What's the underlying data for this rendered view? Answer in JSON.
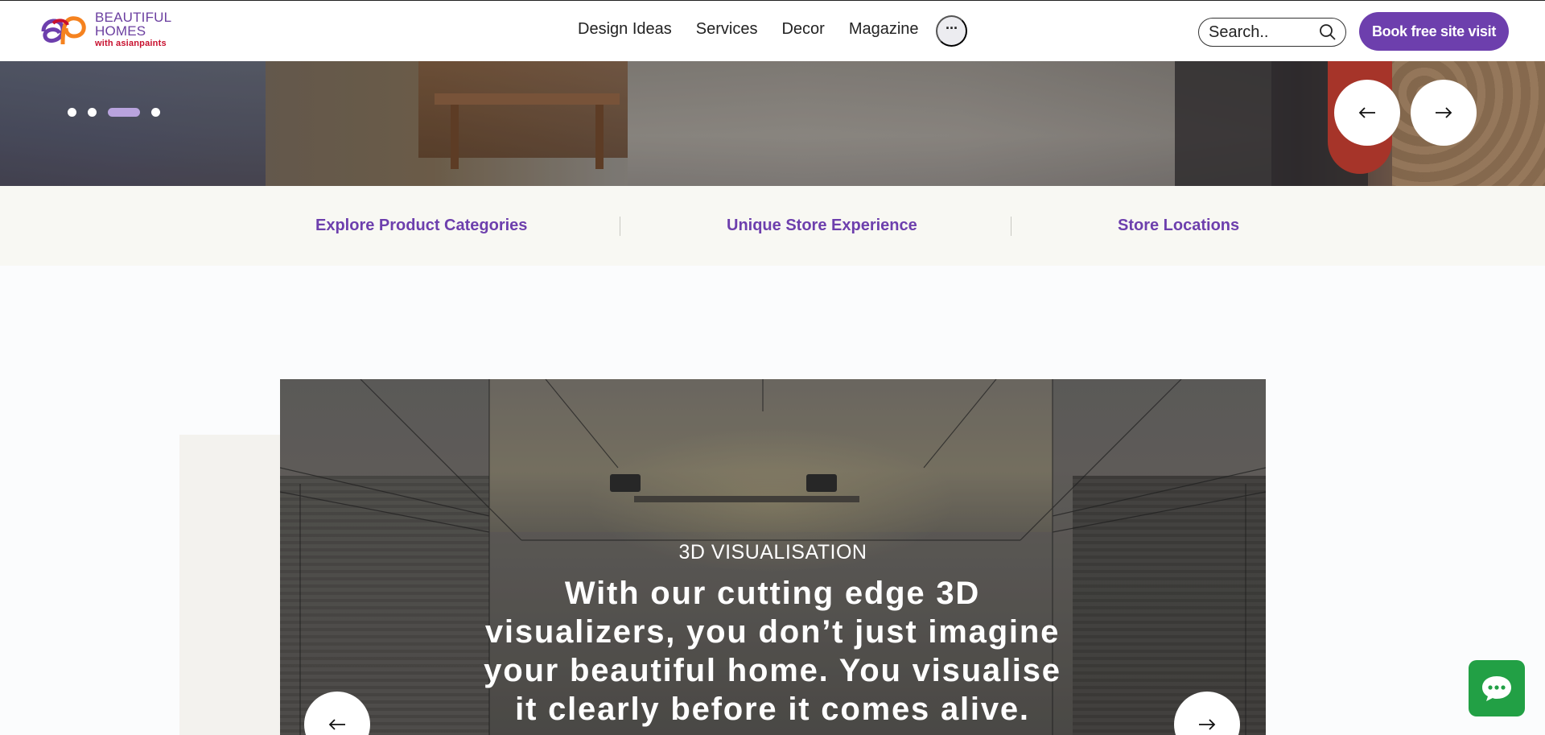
{
  "brand": {
    "line1": "BEAUTIFUL",
    "line2": "HOMES",
    "line3": "with asianpaints",
    "colors": {
      "purple": "#6d3fad",
      "red": "#c8102e",
      "orange": "#f5821f"
    }
  },
  "nav": {
    "items": [
      {
        "label": "Design Ideas"
      },
      {
        "label": "Services"
      },
      {
        "label": "Decor"
      },
      {
        "label": "Magazine"
      }
    ],
    "more_icon": "ellipsis-icon"
  },
  "search": {
    "placeholder": "Search..",
    "icon": "search-icon"
  },
  "cta": {
    "book_label": "Book free site visit",
    "color": "#6d3fad"
  },
  "hero": {
    "slides_total": 4,
    "active_slide": 3,
    "prev_icon": "arrow-left-icon",
    "next_icon": "arrow-right-icon"
  },
  "quick_links": [
    {
      "label": "Explore Product Categories"
    },
    {
      "label": "Unique Store Experience"
    },
    {
      "label": "Store Locations"
    }
  ],
  "feature_card": {
    "eyebrow": "3D VISUALISATION",
    "heading": "With our cutting edge 3D visualizers, you don’t just imagine your beautiful home. You visualise it clearly before it comes alive.",
    "prev_icon": "arrow-left-icon",
    "next_icon": "arrow-right-icon"
  },
  "chat": {
    "icon": "chat-bubble-icon",
    "color": "#22a045"
  }
}
